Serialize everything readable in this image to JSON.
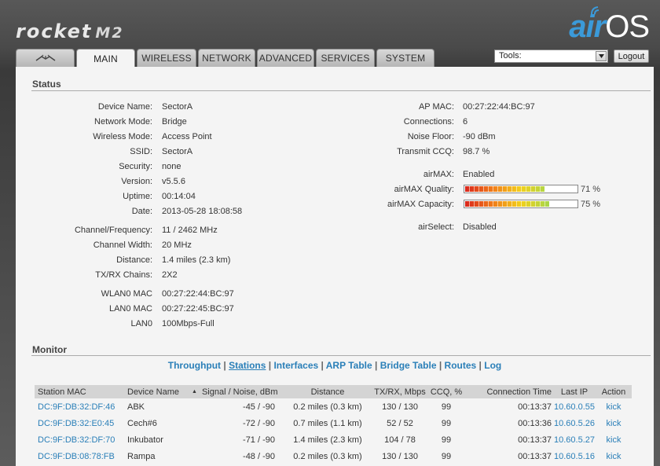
{
  "brand": {
    "name": "rocket",
    "model": "M2"
  },
  "logo": {
    "air": "air",
    "os": "OS"
  },
  "tabs": [
    "MAIN",
    "WIRELESS",
    "NETWORK",
    "ADVANCED",
    "SERVICES",
    "SYSTEM"
  ],
  "tools": {
    "label": "Tools:",
    "logout": "Logout"
  },
  "status": {
    "title": "Status",
    "left": [
      {
        "k": "Device Name:",
        "v": "SectorA"
      },
      {
        "k": "Network Mode:",
        "v": "Bridge"
      },
      {
        "k": "Wireless Mode:",
        "v": "Access Point"
      },
      {
        "k": "SSID:",
        "v": "SectorA"
      },
      {
        "k": "Security:",
        "v": "none"
      },
      {
        "k": "Version:",
        "v": "v5.5.6"
      },
      {
        "k": "Uptime:",
        "v": "00:14:04"
      },
      {
        "k": "Date:",
        "v": "2013-05-28 18:08:58"
      },
      {
        "k": "Channel/Frequency:",
        "v": "11 / 2462 MHz"
      },
      {
        "k": "Channel Width:",
        "v": "20 MHz"
      },
      {
        "k": "Distance:",
        "v": "1.4 miles (2.3 km)"
      },
      {
        "k": "TX/RX Chains:",
        "v": "2X2"
      },
      {
        "k": "WLAN0 MAC",
        "v": "00:27:22:44:BC:97"
      },
      {
        "k": "LAN0 MAC",
        "v": "00:27:22:45:BC:97"
      },
      {
        "k": "LAN0",
        "v": "100Mbps-Full"
      }
    ],
    "right": [
      {
        "k": "AP MAC:",
        "v": "00:27:22:44:BC:97"
      },
      {
        "k": "Connections:",
        "v": "6"
      },
      {
        "k": "Noise Floor:",
        "v": "-90 dBm"
      },
      {
        "k": "Transmit CCQ:",
        "v": "98.7 %"
      },
      {
        "k": "airMAX:",
        "v": "Enabled"
      },
      {
        "k": "airMAX Quality:",
        "v": "71 %"
      },
      {
        "k": "airMAX Capacity:",
        "v": "75 %"
      },
      {
        "k": "airSelect:",
        "v": "Disabled"
      }
    ],
    "airmax_quality": 0.71,
    "airmax_capacity": 0.75
  },
  "monitor": {
    "title": "Monitor",
    "links": [
      "Throughput",
      "Stations",
      "Interfaces",
      "ARP Table",
      "Bridge Table",
      "Routes",
      "Log"
    ],
    "sep": "|",
    "columns": [
      "Station MAC",
      "Device Name",
      "Signal / Noise, dBm",
      "Distance",
      "TX/RX, Mbps",
      "CCQ, %",
      "Connection Time",
      "Last IP",
      "Action"
    ],
    "sort_icon": "▲",
    "rows": [
      [
        "DC:9F:DB:32:DF:46",
        "ABK",
        "-45 / -90",
        "0.2 miles (0.3 km)",
        "130 / 130",
        "99",
        "00:13:37",
        "10.60.0.55",
        "kick"
      ],
      [
        "DC:9F:DB:32:E0:45",
        "Cech#6",
        "-72 / -90",
        "0.7 miles (1.1 km)",
        "52 / 52",
        "99",
        "00:13:36",
        "10.60.5.26",
        "kick"
      ],
      [
        "DC:9F:DB:32:DF:70",
        "Inkubator",
        "-71 / -90",
        "1.4 miles (2.3 km)",
        "104 / 78",
        "99",
        "00:13:37",
        "10.60.5.27",
        "kick"
      ],
      [
        "DC:9F:DB:08:78:FB",
        "Rampa",
        "-48 / -90",
        "0.2 miles (0.3 km)",
        "130 / 130",
        "99",
        "00:13:37",
        "10.60.5.16",
        "kick"
      ]
    ]
  },
  "colors": {
    "link": "#2a7fb8",
    "header_bg": "#4a4a4a",
    "panel_bg": "#f4f4f4"
  }
}
